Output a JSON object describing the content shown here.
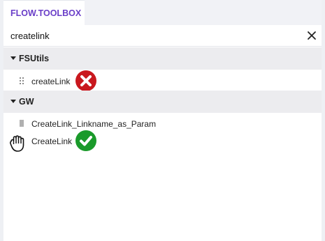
{
  "tab": {
    "label": "FLOW.TOOLBOX"
  },
  "search": {
    "value": "createlink"
  },
  "groups": [
    {
      "label": "FSUtils",
      "items": [
        {
          "label": "createLink",
          "status": "x-circle-icon",
          "status_color": "#c9181e"
        }
      ]
    },
    {
      "label": "GW",
      "items": [
        {
          "label": "CreateLink_Linkname_as_Param"
        },
        {
          "label": "CreateLink",
          "status": "check-circle-icon",
          "status_color": "#1a9a2a"
        }
      ]
    }
  ],
  "colors": {
    "tab_accent": "#6a3ec8",
    "group_header_bg": "#ececef",
    "error": "#c9181e",
    "success": "#1a9a2a"
  },
  "cursor_icon": "grab-hand-icon"
}
